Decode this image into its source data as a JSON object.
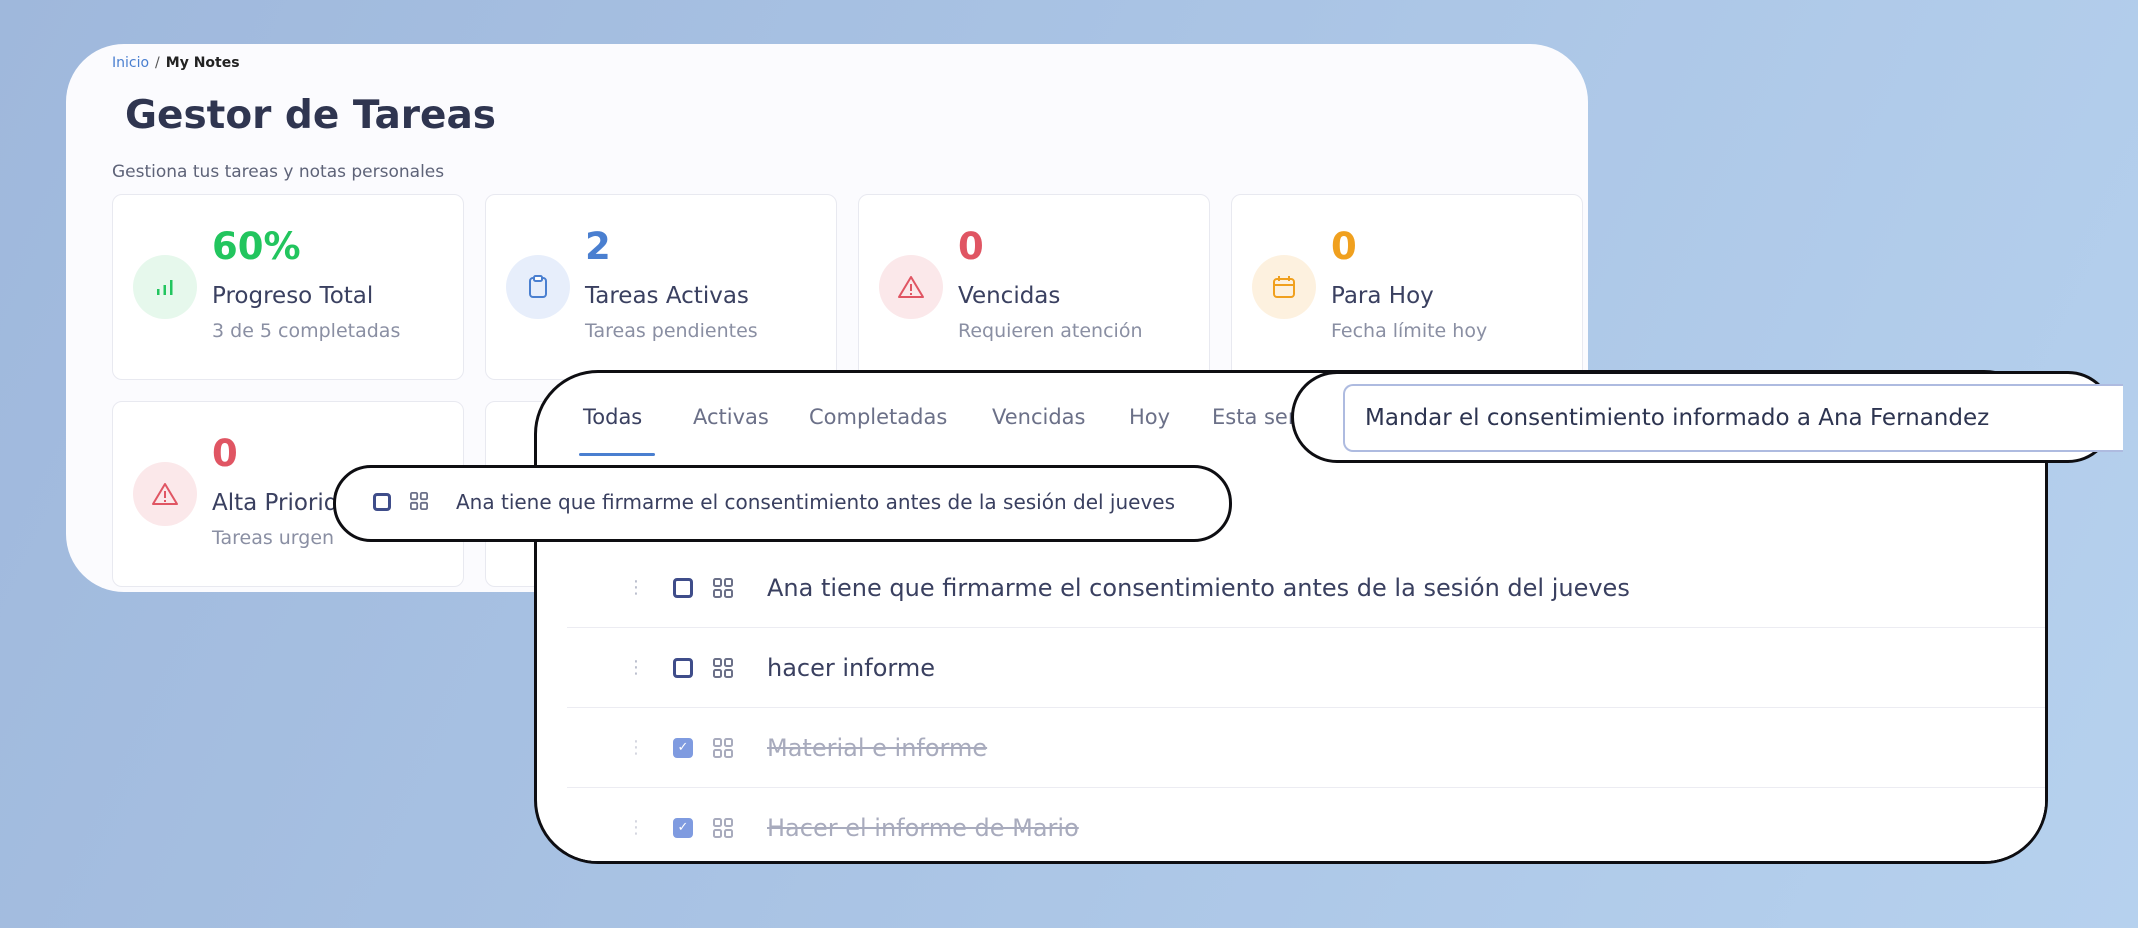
{
  "breadcrumb": {
    "home": "Inicio",
    "separator": "/",
    "current": "My Notes"
  },
  "page": {
    "title": "Gestor de Tareas",
    "subtitle": "Gestiona tus tareas y notas personales"
  },
  "stats": [
    {
      "value": "60%",
      "label": "Progreso Total",
      "sub": "3 de 5 completadas",
      "icon": "bar-chart-icon",
      "color": "#22c55e",
      "bg": "#e6f8ec"
    },
    {
      "value": "2",
      "label": "Tareas Activas",
      "sub": "Tareas pendientes",
      "icon": "clipboard-icon",
      "color": "#4a7fd0",
      "bg": "#e7eefb"
    },
    {
      "value": "0",
      "label": "Vencidas",
      "sub": "Requieren atención",
      "icon": "warning-icon",
      "color": "#e05563",
      "bg": "#fbe8ea"
    },
    {
      "value": "0",
      "label": "Para Hoy",
      "sub": "Fecha límite hoy",
      "icon": "calendar-icon",
      "color": "#f0a01e",
      "bg": "#fdf1df"
    },
    {
      "value": "0",
      "label": "Alta Priorid",
      "sub": "Tareas urgen",
      "icon": "warning-icon",
      "color": "#e05563",
      "bg": "#fbe8ea"
    }
  ],
  "tabs": [
    "Todas",
    "Activas",
    "Completadas",
    "Vencidas",
    "Hoy",
    "Esta sen"
  ],
  "search": {
    "value": "Mandar el consentimiento informado a Ana Fernandez"
  },
  "dragging_item": {
    "text": "Ana tiene que firmarme el consentimiento antes de la sesión del jueves"
  },
  "tasks": [
    {
      "text": "Ana tiene que firmarme el consentimiento antes de la sesión del jueves",
      "done": false
    },
    {
      "text": "hacer informe",
      "done": false
    },
    {
      "text": "Material e informe",
      "done": true
    },
    {
      "text": "Hacer el informe de Mario",
      "done": true
    }
  ],
  "colors": {
    "accent": "#4a7fd0",
    "background": "#a9c3e4",
    "checked": "#7f9be0"
  }
}
